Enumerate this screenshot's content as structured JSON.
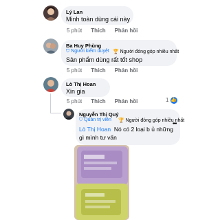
{
  "comments": [
    {
      "name": "Lý Lan",
      "text": "Minh toàn dùng cái này",
      "time": "5 phút",
      "like": "Thích",
      "reply": "Phản hồi"
    },
    {
      "name": "Ba Huy Phùng",
      "badge": "Người kiểm duyệt",
      "badge2": "Người đóng góp nhiều nhất",
      "text": "Sản phẩm dùng rất tốt shop",
      "time": "5 phút",
      "like": "Thích",
      "reply": "Phản hồi"
    },
    {
      "name": "Lò Thị Hoan",
      "text": "Xin gia",
      "time": "5 phút",
      "like": "Thích",
      "reply": "Phản hồi",
      "reaction_count": "1"
    },
    {
      "name": "Nguyễn Thị Quý",
      "badge": "Quản trị viên",
      "badge2": "Người đóng góp nhiều nhất",
      "mention": "Lò Thị Hoan",
      "text_line1": "Nó có 2 loại b ủ những",
      "text_line2": "gì mình tư vấn",
      "more": "•••"
    }
  ],
  "colors": {
    "accent": "#1877f2",
    "bubble": "#f0f2f5",
    "muted": "#65676b"
  }
}
